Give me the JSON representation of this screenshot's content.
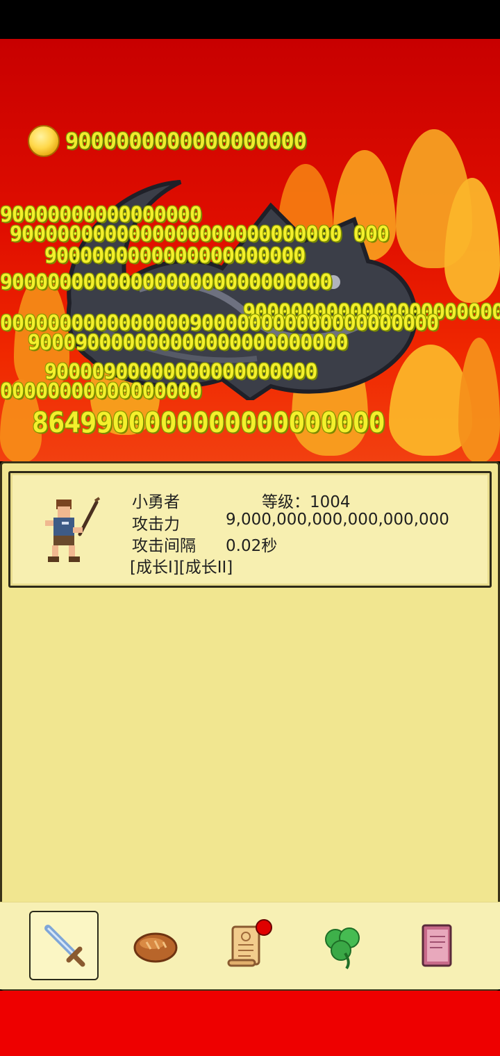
{
  "gold": {
    "amount": "9000000000000000000",
    "icon": "gold-coin-icon"
  },
  "damage_popups": [
    "90000000000000000",
    "9000000000000000000000000000 000",
    "9000000000000000000000",
    "9000000000000000000000000000",
    "9000000000000000000000",
    "0000000000000000900000000000000000000",
    "900090000000000000000000000",
    "90000900000000000000000",
    "00000000000000000",
    "8649900000000000000000"
  ],
  "hero": {
    "name": "小勇者",
    "level_text": "等级：1004",
    "attack_label": "攻击力",
    "attack_value": "9,000,000,000,000,000,000",
    "interval_label": "攻击间隔",
    "interval_value": "0.02秒",
    "tags": "[成长I][成长II]"
  },
  "nav": [
    {
      "id": "weapon",
      "icon": "sword-icon",
      "selected": true
    },
    {
      "id": "food",
      "icon": "bread-icon",
      "selected": false
    },
    {
      "id": "quest",
      "icon": "scroll-icon",
      "selected": false,
      "notification": true
    },
    {
      "id": "luck",
      "icon": "clover-icon",
      "selected": false
    },
    {
      "id": "book",
      "icon": "book-icon",
      "selected": false
    }
  ],
  "colors": {
    "battle_background": "#d80800",
    "panel": "#f1e690",
    "damage_text": "#f4f02c",
    "notification_dot": "#e00000"
  }
}
